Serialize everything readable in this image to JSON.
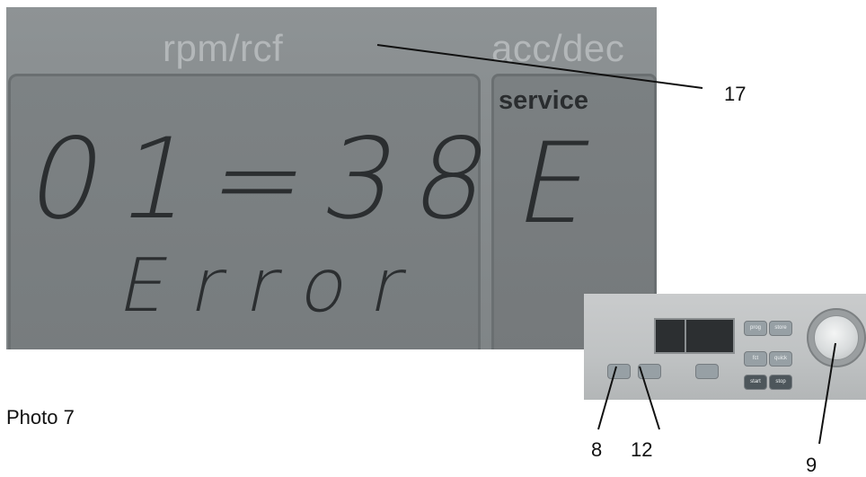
{
  "display": {
    "header_left": "rpm/rcf",
    "header_right": "acc/dec",
    "time_readout": "01=38",
    "message": "Error",
    "service_label": "service",
    "service_code": "E"
  },
  "panel_buttons": [
    "prog",
    "store",
    "fct",
    "quick",
    "start",
    "stop"
  ],
  "callouts": {
    "c17": "17",
    "c8": "8",
    "c12": "12",
    "c9": "9"
  },
  "caption": "Photo 7"
}
